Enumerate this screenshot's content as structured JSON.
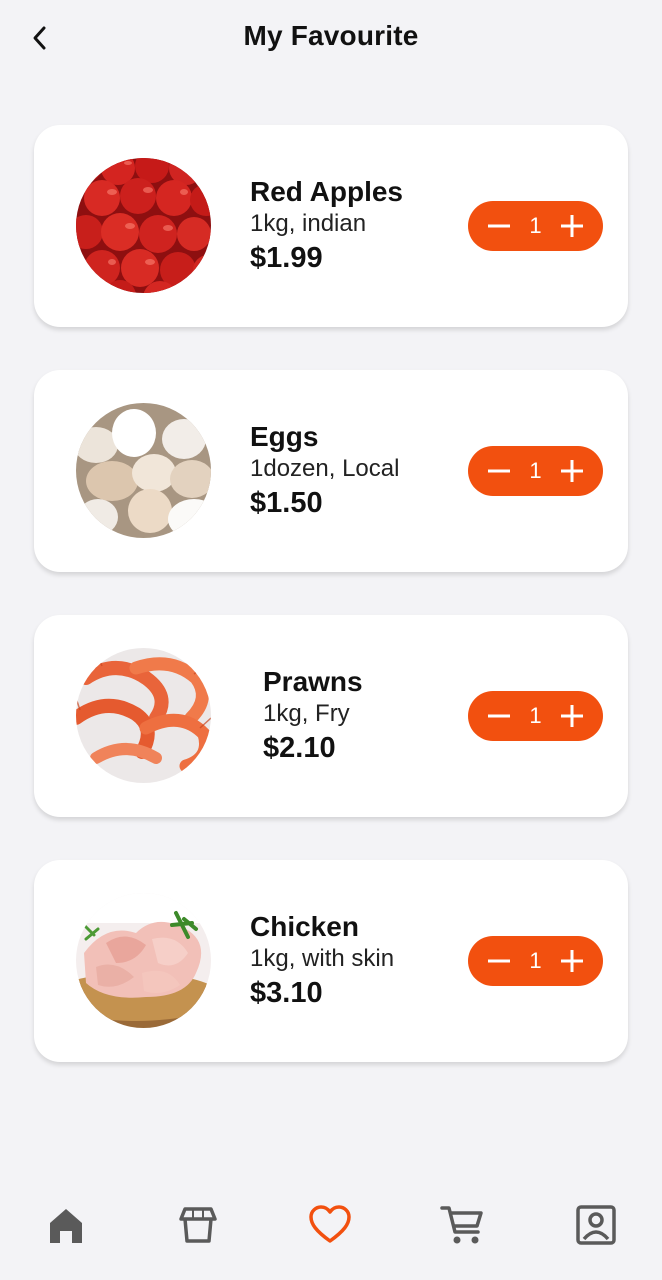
{
  "header": {
    "title": "My Favourite",
    "back_icon": "chevron-left-icon"
  },
  "colors": {
    "accent": "#f2500f",
    "background": "#f3f3f6",
    "card": "#ffffff",
    "nav_icon": "#5a5a5a"
  },
  "items": [
    {
      "name": "Red Apples",
      "desc": "1kg, indian",
      "price": "$1.99",
      "qty": "1",
      "image": "red-apples"
    },
    {
      "name": "Eggs",
      "desc": "1dozen, Local",
      "price": "$1.50",
      "qty": "1",
      "image": "eggs"
    },
    {
      "name": "Prawns",
      "desc": "1kg, Fry",
      "price": "$2.10",
      "qty": "1",
      "image": "prawns"
    },
    {
      "name": "Chicken",
      "desc": "1kg, with skin",
      "price": "$3.10",
      "qty": "1",
      "image": "chicken"
    }
  ],
  "nav": [
    {
      "icon": "home-icon",
      "active": false
    },
    {
      "icon": "store-icon",
      "active": false
    },
    {
      "icon": "heart-icon",
      "active": true
    },
    {
      "icon": "cart-icon",
      "active": false
    },
    {
      "icon": "profile-icon",
      "active": false
    }
  ]
}
